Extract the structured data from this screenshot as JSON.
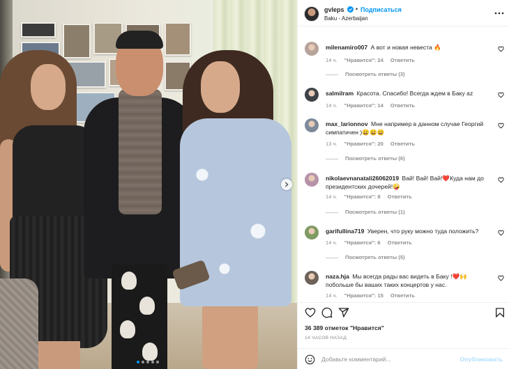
{
  "post": {
    "username": "gvleps",
    "follow_label": "Подписаться",
    "separator": "•",
    "location": "Baku - Azerbaijan"
  },
  "comments": [
    {
      "username": "milenamiro007",
      "text": "А вот и новая невеста 🔥",
      "age": "14 ч.",
      "likes": "\"Нравится\": 24",
      "reply": "Ответить",
      "replies": "Посмотреть ответы (3)",
      "avatar_color": "#b7a39a"
    },
    {
      "username": "salmilram",
      "text": "Красота. Спасибо! Всегда ждем в Баку az",
      "age": "14 ч.",
      "likes": "\"Нравится\": 14",
      "reply": "Ответить",
      "replies": "",
      "avatar_color": "#3d4247"
    },
    {
      "username": "max_larionnov",
      "text": "Мне например в данном случае Георгий симпатичен )😄😄😄",
      "age": "13 ч.",
      "likes": "\"Нравится\": 20",
      "reply": "Ответить",
      "replies": "Посмотреть ответы (6)",
      "avatar_color": "#7d8a9a"
    },
    {
      "username": "nikolaevnanatali26062019",
      "text": "Вай! Вай! Вай!❤️Куда нам до президентских дочерей!🤪",
      "age": "14 ч.",
      "likes": "\"Нравится\": 8",
      "reply": "Ответить",
      "replies": "Посмотреть ответы (1)",
      "avatar_color": "#b693a8"
    },
    {
      "username": "garifullina719",
      "text": "Уверен, что руку можно туда положить?",
      "age": "14 ч.",
      "likes": "\"Нравится\": 6",
      "reply": "Ответить",
      "replies": "Посмотреть ответы (5)",
      "avatar_color": "#7e9b62"
    },
    {
      "username": "naza.hja",
      "text": "Мы всегда рады вас видеть в Баку !❤️🙌 побольше бы ваших таких концертов у нас.",
      "age": "14 ч.",
      "likes": "\"Нравится\": 15",
      "reply": "Ответить",
      "replies": "",
      "avatar_color": "#6e6157"
    }
  ],
  "likes_count": "36 389 отметок \"Нравится\"",
  "posted_ago": "14 ЧАСОВ НАЗАД",
  "comment_box": {
    "placeholder": "Добавьте комментарий...",
    "publish_label": "Опубликовать"
  },
  "colors": {
    "accent": "#0095f6",
    "publish_disabled": "#b2dffc",
    "secondary_text": "#8e8e8e"
  },
  "icons": [
    "verified-badge-icon",
    "more-options-icon",
    "heart-icon",
    "comment-icon",
    "share-icon",
    "bookmark-icon",
    "emoji-icon",
    "chevron-right-icon"
  ],
  "carousel": {
    "slides": 5,
    "active_slide": 1
  }
}
